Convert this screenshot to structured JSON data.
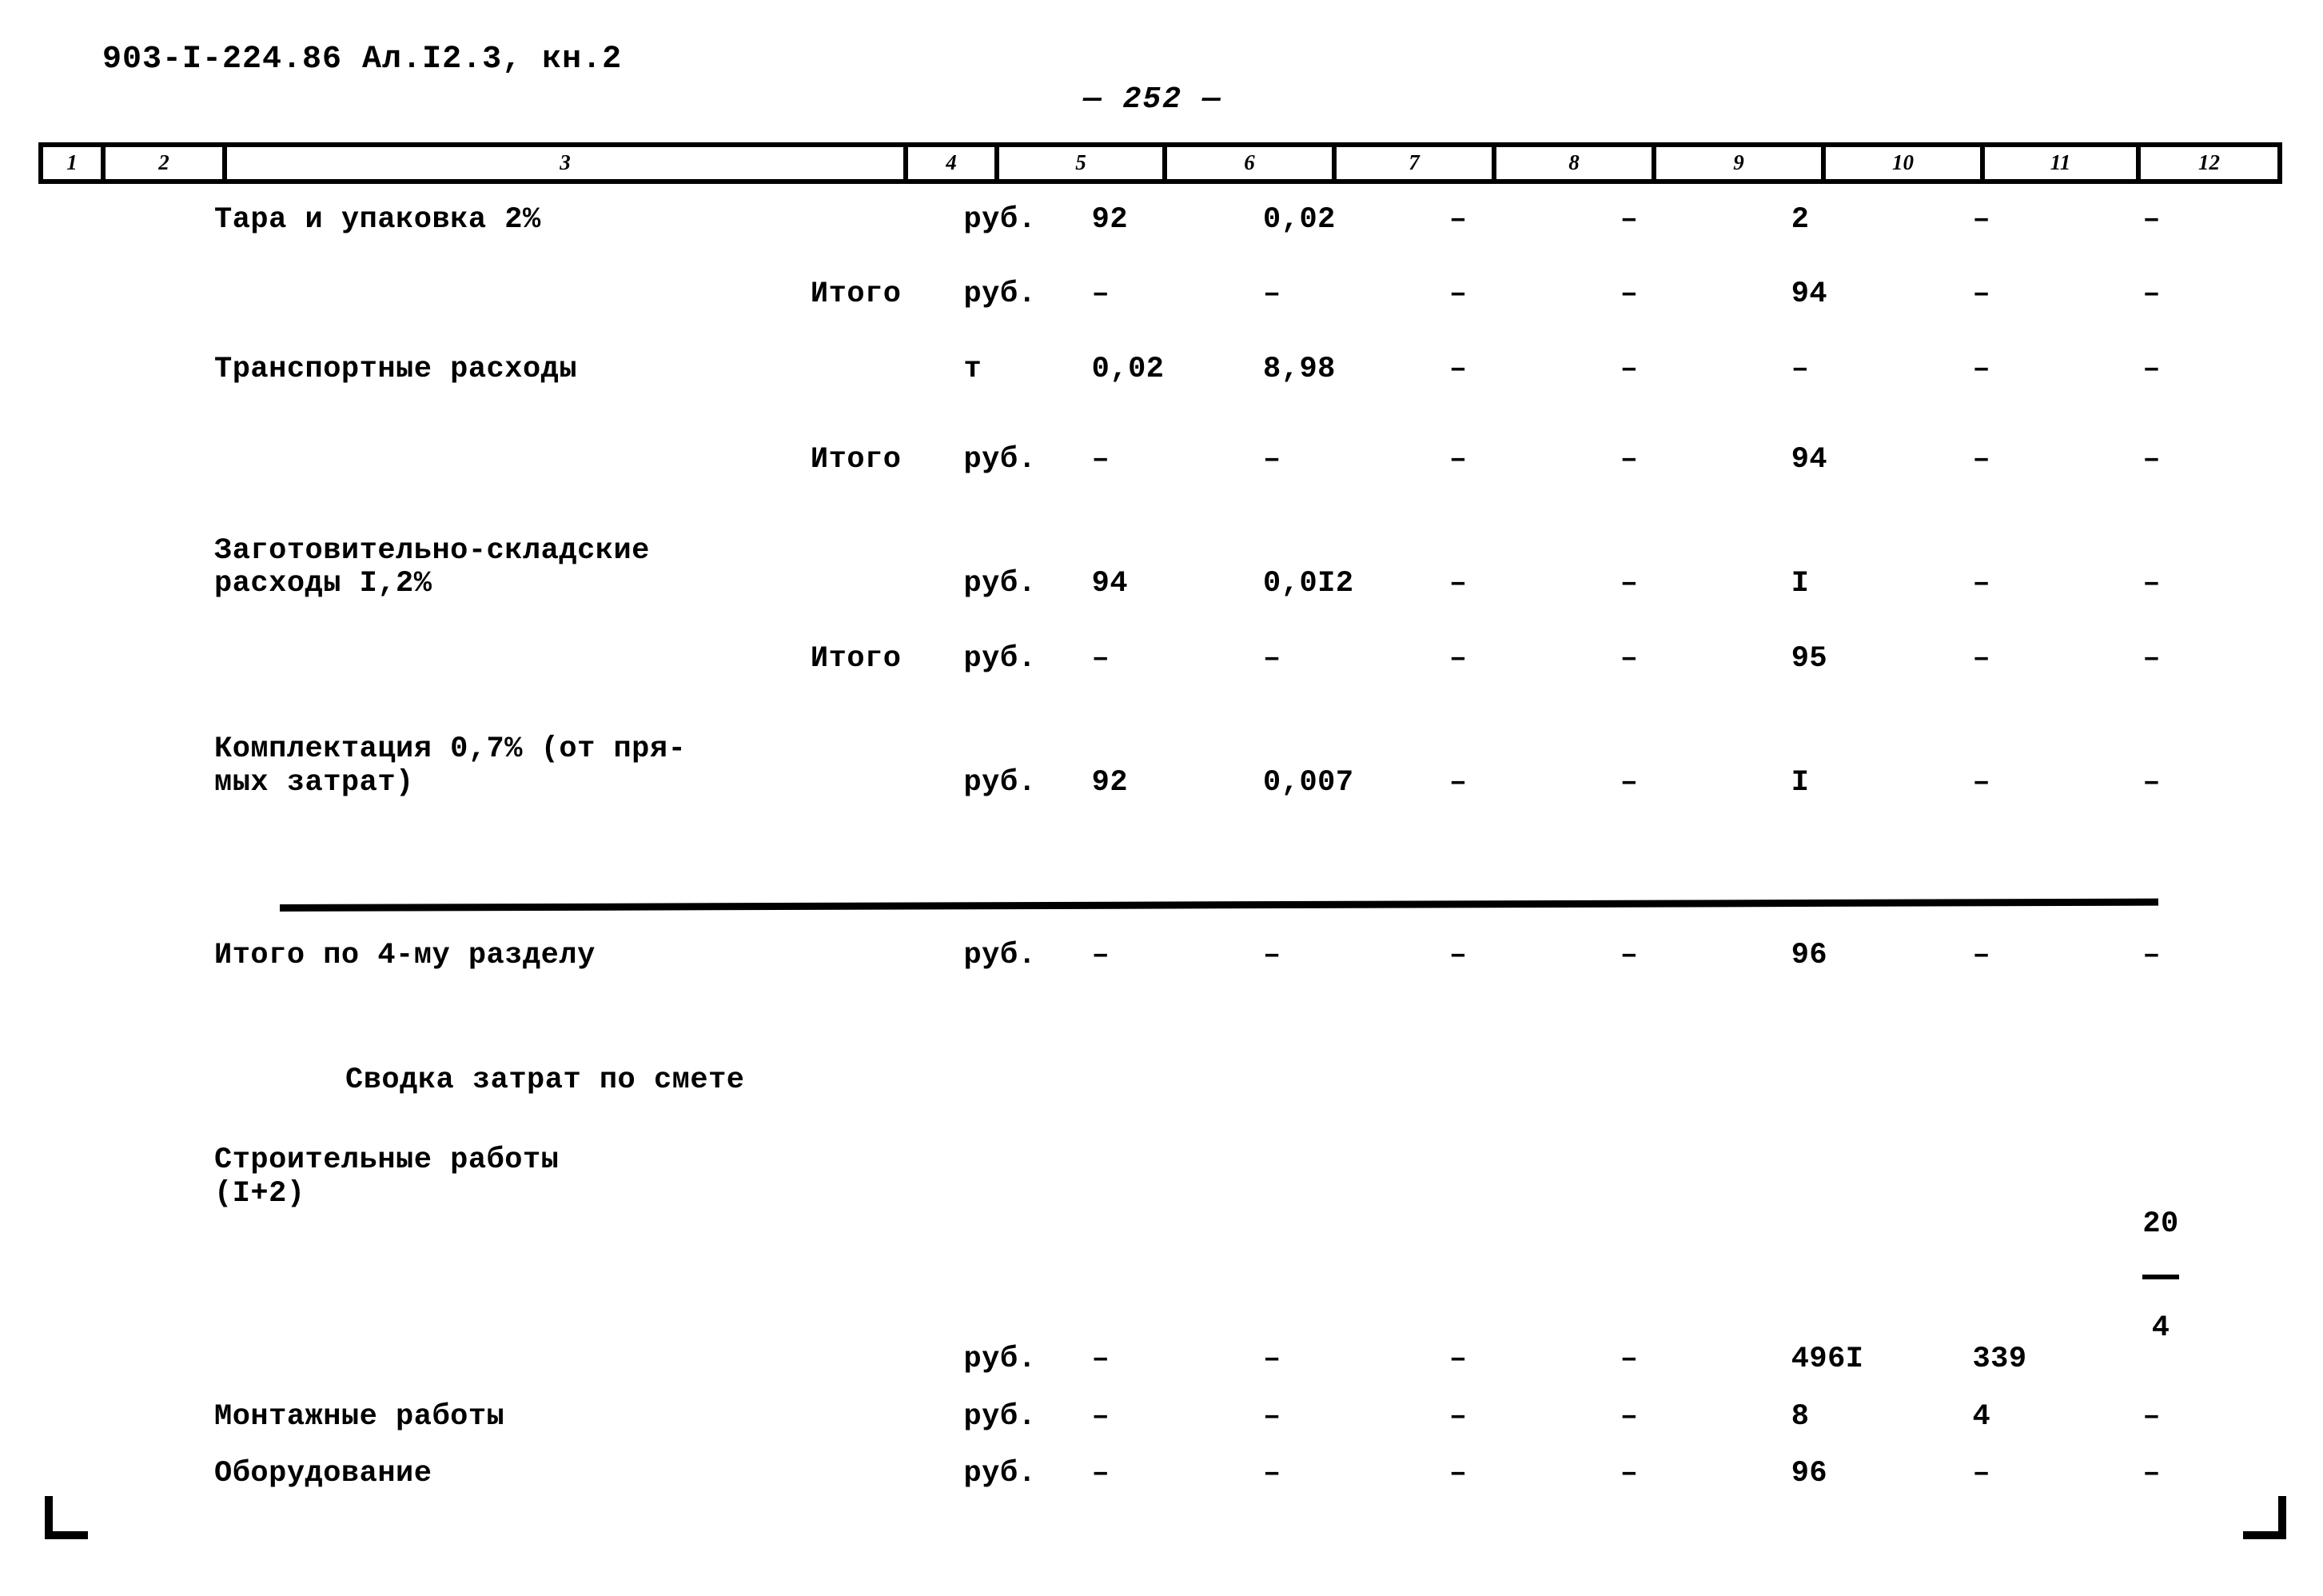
{
  "document": {
    "header_code": "903-I-224.86  Ал.I2.3, кн.2",
    "page_number": "— 252 —"
  },
  "column_ruler": {
    "labels": [
      "1",
      "2",
      "3",
      "4",
      "5",
      "6",
      "7",
      "8",
      "9",
      "10",
      "11",
      "12"
    ]
  },
  "dash": "–",
  "rows": [
    {
      "name": "Тара и упаковка 2%",
      "unit": "руб.",
      "c5": "92",
      "c6": "0,02",
      "c7": "–",
      "c8": "–",
      "c9": "2",
      "c10": "–",
      "c11": "–"
    },
    {
      "name": "Итого",
      "unit": "руб.",
      "c5": "–",
      "c6": "–",
      "c7": "–",
      "c8": "–",
      "c9": "94",
      "c10": "–",
      "c11": "–"
    },
    {
      "name": "Транспортные расходы",
      "unit": "т",
      "c5": "0,02",
      "c6": "8,98",
      "c7": "–",
      "c8": "–",
      "c9": "–",
      "c10": "–",
      "c11": "–"
    },
    {
      "name": "Итого",
      "unit": "руб.",
      "c5": "–",
      "c6": "–",
      "c7": "–",
      "c8": "–",
      "c9": "94",
      "c10": "–",
      "c11": "–"
    },
    {
      "name": "Заготовительно-складские\nрасходы I,2%",
      "unit": "руб.",
      "c5": "94",
      "c6": "0,0I2",
      "c7": "–",
      "c8": "–",
      "c9": "I",
      "c10": "–",
      "c11": "–"
    },
    {
      "name": "Итого",
      "unit": "руб.",
      "c5": "–",
      "c6": "–",
      "c7": "–",
      "c8": "–",
      "c9": "95",
      "c10": "–",
      "c11": "–"
    },
    {
      "name": "Комплектация 0,7% (от пря-\nмых затрат)",
      "unit": "руб.",
      "c5": "92",
      "c6": "0,007",
      "c7": "–",
      "c8": "–",
      "c9": "I",
      "c10": "–",
      "c11": "–"
    }
  ],
  "section_total": {
    "name": "Итого по 4-му разделу",
    "unit": "руб.",
    "c5": "–",
    "c6": "–",
    "c7": "–",
    "c8": "–",
    "c9": "96",
    "c10": "–",
    "c11": "–"
  },
  "summary": {
    "heading": "Сводка затрат по смете",
    "rows": [
      {
        "name": "Строительные работы\n(I+2)",
        "unit": "руб.",
        "c5": "–",
        "c6": "–",
        "c7": "–",
        "c8": "–",
        "c9": "496I",
        "c10": "339",
        "c11_numerator": "20",
        "c11_denominator": "4"
      },
      {
        "name": "Монтажные работы",
        "unit": "руб.",
        "c5": "–",
        "c6": "–",
        "c7": "–",
        "c8": "–",
        "c9": "8",
        "c10": "4",
        "c11": "–"
      },
      {
        "name": "Оборудование",
        "unit": "руб.",
        "c5": "–",
        "c6": "–",
        "c7": "–",
        "c8": "–",
        "c9": "96",
        "c10": "–",
        "c11": "–"
      }
    ]
  }
}
